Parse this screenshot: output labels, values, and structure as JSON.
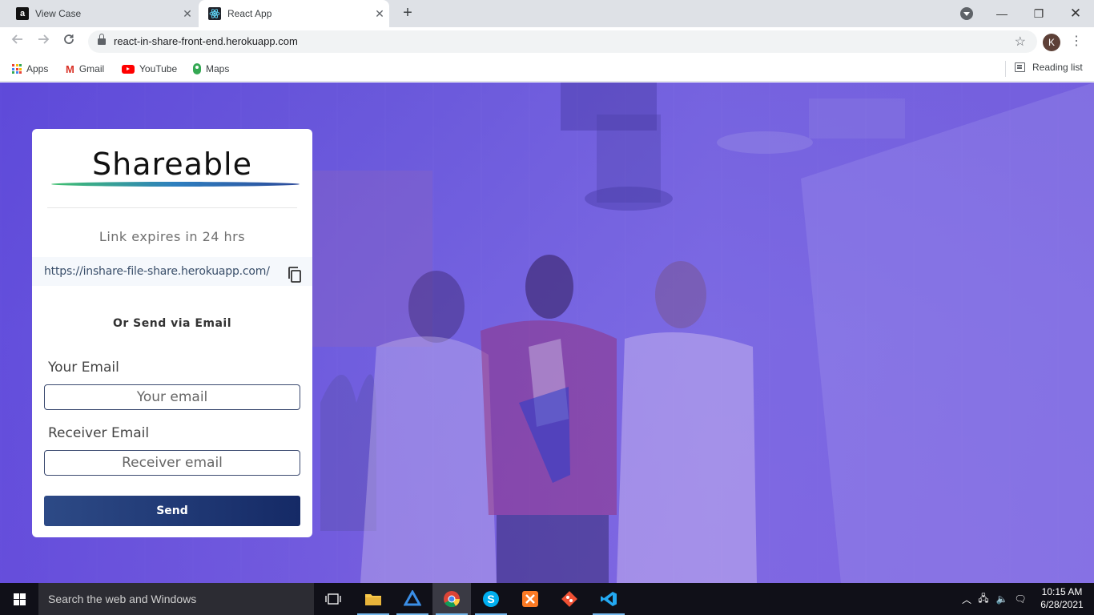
{
  "browser": {
    "tabs": [
      {
        "title": "View Case",
        "favicon": "amazon-icon"
      },
      {
        "title": "React App",
        "favicon": "react-icon"
      }
    ],
    "url": "react-in-share-front-end.herokuapp.com",
    "profile_initial": "K",
    "bookmarks": [
      {
        "label": "Apps",
        "icon": "apps-grid-icon"
      },
      {
        "label": "Gmail",
        "icon": "gmail-icon"
      },
      {
        "label": "YouTube",
        "icon": "youtube-icon"
      },
      {
        "label": "Maps",
        "icon": "maps-icon"
      }
    ],
    "reading_list": "Reading list"
  },
  "card": {
    "logo": "Shareable",
    "expires": "Link expires in 24 hrs",
    "link": "https://inshare-file-share.herokuapp.com/",
    "or_send": "Or Send via Email",
    "your_email_label": "Your Email",
    "your_email_placeholder": "Your email",
    "receiver_email_label": "Receiver Email",
    "receiver_email_placeholder": "Receiver email",
    "send_label": "Send"
  },
  "taskbar": {
    "search_placeholder": "Search the web and Windows",
    "time": "10:15 AM",
    "date": "6/28/2021"
  },
  "colors": {
    "page_overlay": "#6a55e0",
    "send_button": "#1f3572",
    "taskbar": "#101018"
  }
}
